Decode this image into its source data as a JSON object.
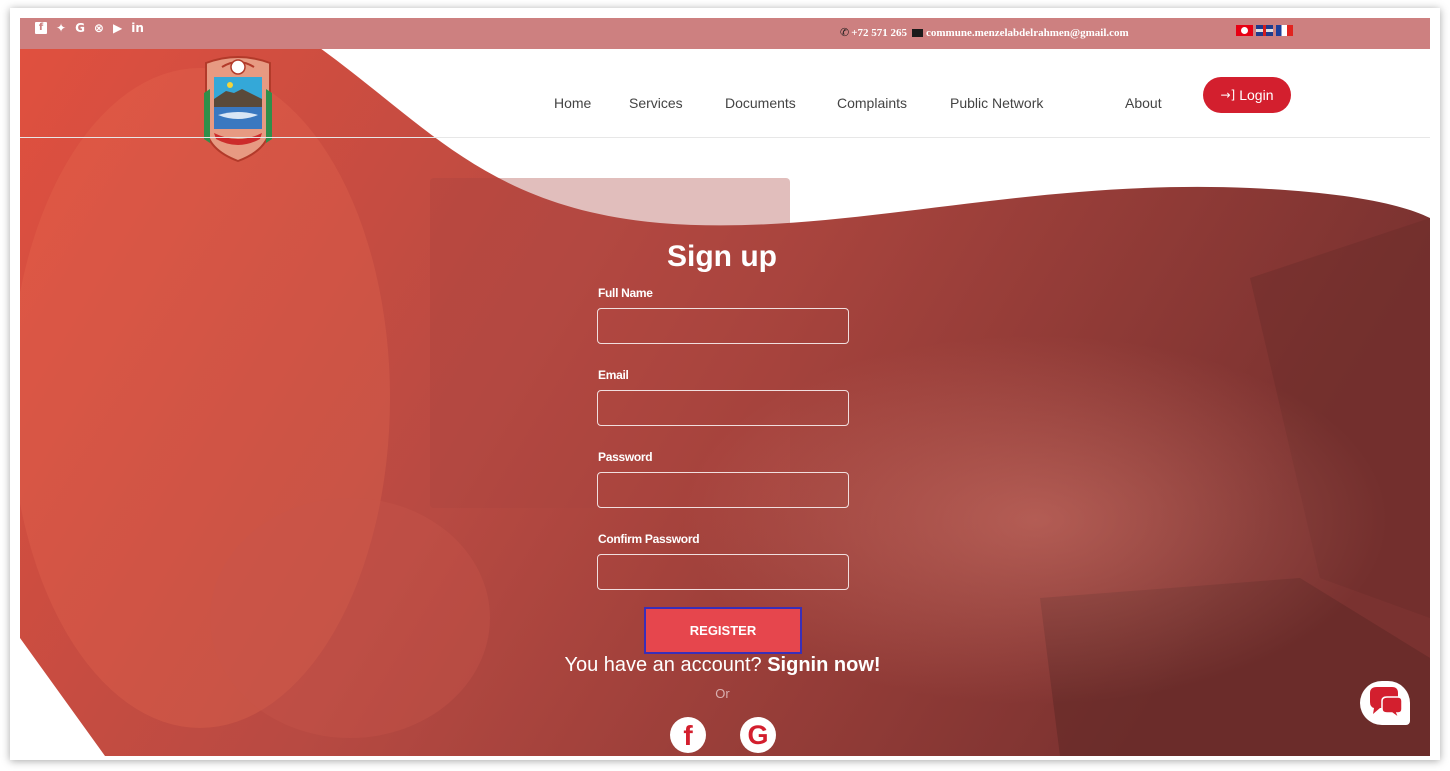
{
  "topbar": {
    "social_icons": [
      "facebook-icon",
      "twitter-icon",
      "google-icon",
      "pinterest-icon",
      "youtube-icon",
      "linkedin-icon"
    ],
    "social_glyphs": {
      "facebook": "f",
      "twitter": "✦",
      "google": "G",
      "pinterest": "⊗",
      "youtube": "▶",
      "linkedin": "in"
    },
    "phone": "+72 571 265",
    "email": "commune.menzelabdelrahmen@gmail.com",
    "languages": [
      "flag-tn",
      "flag-uk",
      "flag-fr"
    ]
  },
  "nav": {
    "items": [
      {
        "label": "Home"
      },
      {
        "label": "Services"
      },
      {
        "label": "Documents"
      },
      {
        "label": "Complaints"
      },
      {
        "label": "Public Network"
      },
      {
        "label": "About"
      }
    ],
    "login_label": "Login",
    "login_icon": "→]"
  },
  "form": {
    "title": "Sign up",
    "fields": [
      {
        "label": "Full Name",
        "value": "",
        "placeholder": ""
      },
      {
        "label": "Email",
        "value": "",
        "placeholder": ""
      },
      {
        "label": "Password",
        "value": "",
        "placeholder": ""
      },
      {
        "label": "Confirm Password",
        "value": "",
        "placeholder": ""
      }
    ],
    "register_label": "REGISTER",
    "account_prompt": "You have an account? ",
    "signin_link": "Signin now!",
    "or_text": "Or",
    "facebook_glyph": "f",
    "google_glyph": "G"
  },
  "colors": {
    "topbar": "#cd8080",
    "hero_red": "#c9473d",
    "login_button": "#d31f2e",
    "register_button": "#e6464d"
  }
}
